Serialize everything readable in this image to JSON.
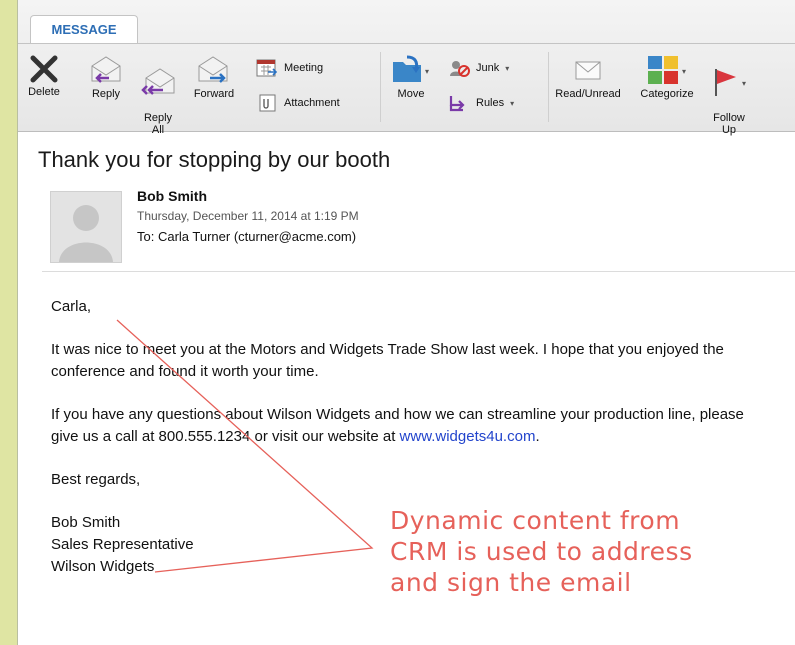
{
  "ribbon": {
    "tab_label": "MESSAGE",
    "buttons": {
      "delete": "Delete",
      "reply": "Reply",
      "reply_all": "Reply\nAll",
      "forward": "Forward",
      "meeting": "Meeting",
      "attachment": "Attachment",
      "move": "Move",
      "junk": "Junk",
      "rules": "Rules",
      "read_unread": "Read/Unread",
      "categorize": "Categorize",
      "follow_up": "Follow\nUp"
    }
  },
  "message": {
    "subject": "Thank you for stopping by our booth",
    "sender": "Bob Smith",
    "date": "Thursday, December 11, 2014 at 1:19 PM",
    "to": "To: Carla Turner (cturner@acme.com)",
    "greeting": "Carla,",
    "para1": "It was nice to meet you at the Motors and Widgets Trade Show last week. I hope that you enjoyed the conference and found it worth your time.",
    "para2": "If you have any questions about Wilson Widgets and how we can streamline your production line, please give us a call at 800.555.1234 or visit our website at",
    "link": "www.widgets4u.com",
    "para2_end": ".",
    "closing": "Best regards,",
    "signature_name": "Bob Smith",
    "signature_title": "Sales Representative",
    "signature_company": "Wilson Widgets"
  },
  "annotation": {
    "line1": "Dynamic content from",
    "line2": "CRM is used to address",
    "line3": "and sign the email",
    "color": "#e6615a"
  },
  "colors": {
    "background": "#dfe5a3",
    "tab_text": "#2d6eb5",
    "link": "#2244cc",
    "flag": "#d9363e"
  }
}
